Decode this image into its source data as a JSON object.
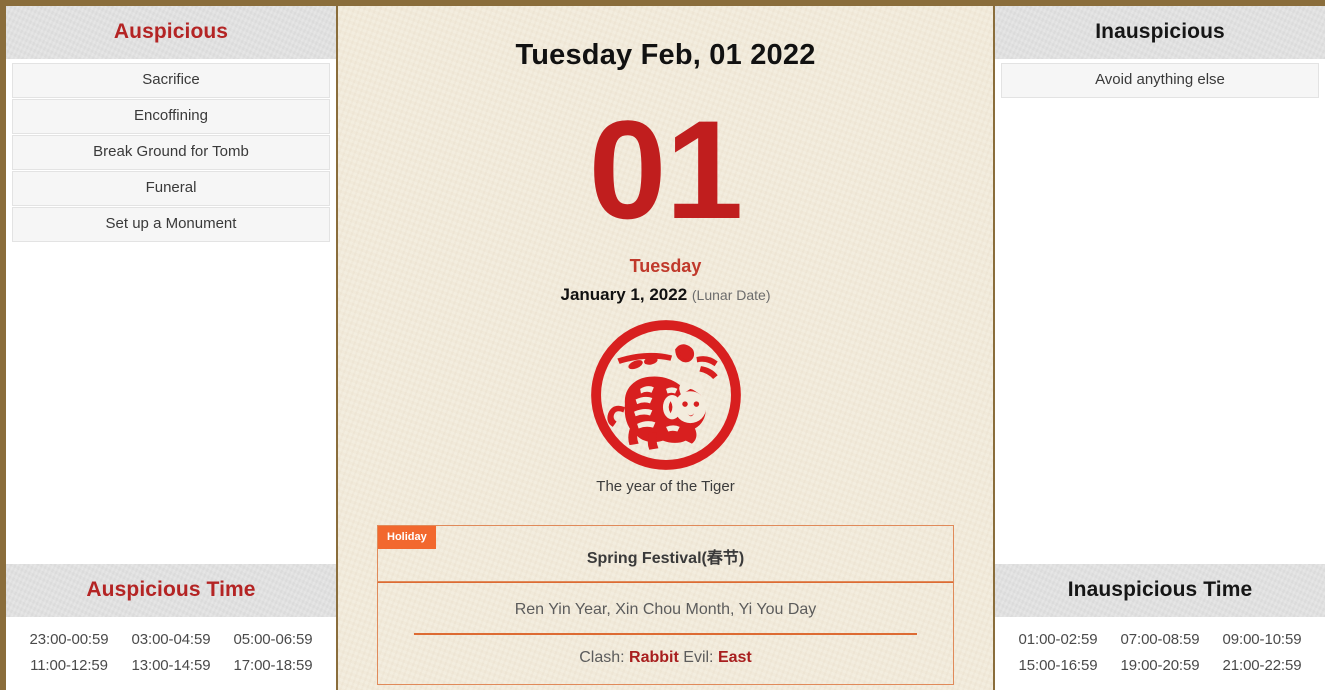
{
  "theme": {
    "frame_color": "#8a6d3b",
    "accent_red": "#b42424",
    "day_number_red": "#c01e1e",
    "holiday_orange": "#f2682e",
    "paper_cream": "#f3ecdd"
  },
  "left_panel": {
    "top": {
      "title": "Auspicious",
      "items": [
        "Sacrifice",
        "Encoffining",
        "Break Ground for Tomb",
        "Funeral",
        "Set up a Monument"
      ]
    },
    "bottom": {
      "title": "Auspicious Time",
      "times": [
        "23:00-00:59",
        "03:00-04:59",
        "05:00-06:59",
        "11:00-12:59",
        "13:00-14:59",
        "17:00-18:59"
      ]
    }
  },
  "right_panel": {
    "top": {
      "title": "Inauspicious",
      "items": [
        "Avoid anything else"
      ]
    },
    "bottom": {
      "title": "Inauspicious Time",
      "times": [
        "01:00-02:59",
        "07:00-08:59",
        "09:00-10:59",
        "15:00-16:59",
        "19:00-20:59",
        "21:00-22:59"
      ]
    }
  },
  "center": {
    "header_date": "Tuesday Feb, 01 2022",
    "day_number": "01",
    "weekday": "Tuesday",
    "lunar_date": "January 1, 2022",
    "lunar_note": "(Lunar Date)",
    "zodiac_icon": "tiger-papercut-icon",
    "zodiac_caption": "The year of the Tiger",
    "holiday_badge": "Holiday",
    "festival_name": "Spring Festival(春节)",
    "ganzhi": "Ren Yin Year, Xin Chou Month, Yi You Day",
    "clash_prefix": "Clash: ",
    "clash_value": "Rabbit",
    "evil_prefix": " Evil: ",
    "evil_value": "East"
  }
}
